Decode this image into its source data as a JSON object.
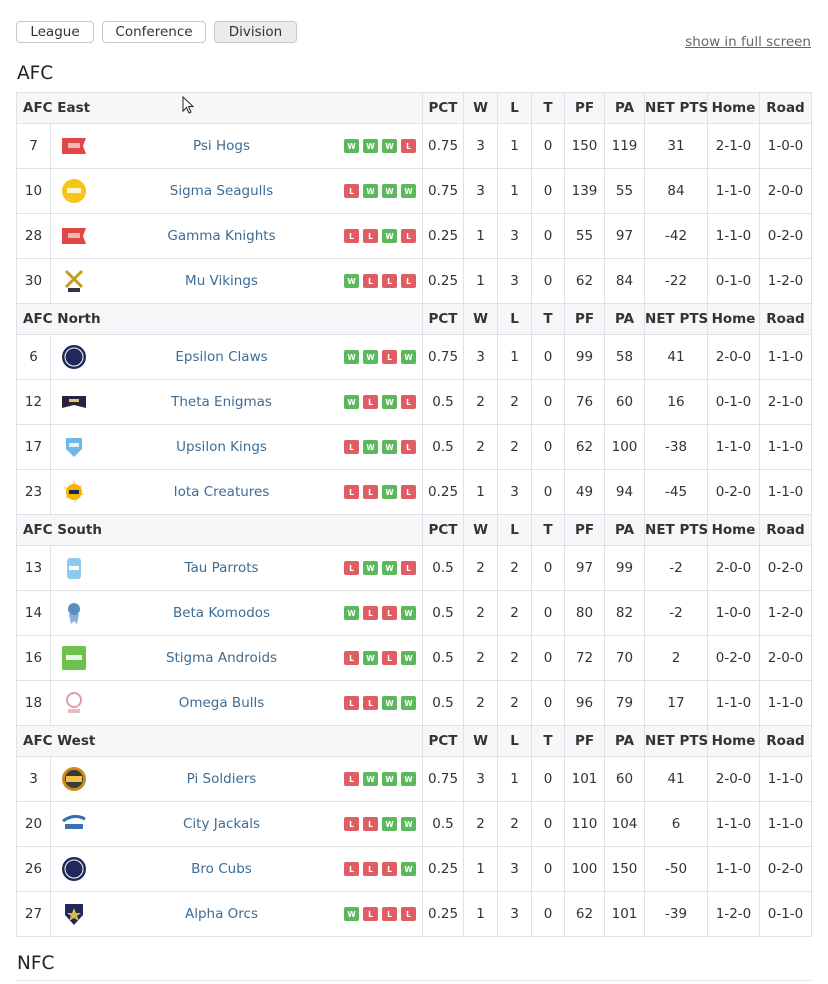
{
  "tabs": [
    {
      "label": "League",
      "active": false
    },
    {
      "label": "Conference",
      "active": false
    },
    {
      "label": "Division",
      "active": true
    }
  ],
  "fullscreen_link": "show in full screen",
  "conferences": [
    {
      "name": "AFC",
      "divisions": [
        {
          "name": "AFC East",
          "teams": [
            {
              "seed": "7",
              "name": "Psi Hogs",
              "logo": "red-flag-logo",
              "streak": [
                "W",
                "W",
                "W",
                "L"
              ],
              "pct": "0.75",
              "w": "3",
              "l": "1",
              "t": "0",
              "pf": "150",
              "pa": "119",
              "net": "31",
              "home": "2-1-0",
              "road": "1-0-0"
            },
            {
              "seed": "10",
              "name": "Sigma Seagulls",
              "logo": "yellow-circle-logo",
              "streak": [
                "L",
                "W",
                "W",
                "W"
              ],
              "pct": "0.75",
              "w": "3",
              "l": "1",
              "t": "0",
              "pf": "139",
              "pa": "55",
              "net": "84",
              "home": "1-1-0",
              "road": "2-0-0"
            },
            {
              "seed": "28",
              "name": "Gamma Knights",
              "logo": "red-flag-logo",
              "streak": [
                "L",
                "L",
                "W",
                "L"
              ],
              "pct": "0.25",
              "w": "1",
              "l": "3",
              "t": "0",
              "pf": "55",
              "pa": "97",
              "net": "-42",
              "home": "1-1-0",
              "road": "0-2-0"
            },
            {
              "seed": "30",
              "name": "Mu Vikings",
              "logo": "crossed-axes-logo",
              "streak": [
                "W",
                "L",
                "L",
                "L"
              ],
              "pct": "0.25",
              "w": "1",
              "l": "3",
              "t": "0",
              "pf": "62",
              "pa": "84",
              "net": "-22",
              "home": "0-1-0",
              "road": "1-2-0"
            }
          ]
        },
        {
          "name": "AFC North",
          "teams": [
            {
              "seed": "6",
              "name": "Epsilon Claws",
              "logo": "navy-circle-logo",
              "streak": [
                "W",
                "W",
                "L",
                "W"
              ],
              "pct": "0.75",
              "w": "3",
              "l": "1",
              "t": "0",
              "pf": "99",
              "pa": "58",
              "net": "41",
              "home": "2-0-0",
              "road": "1-1-0"
            },
            {
              "seed": "12",
              "name": "Theta Enigmas",
              "logo": "dark-banner-logo",
              "streak": [
                "W",
                "L",
                "W",
                "L"
              ],
              "pct": "0.5",
              "w": "2",
              "l": "2",
              "t": "0",
              "pf": "76",
              "pa": "60",
              "net": "16",
              "home": "0-1-0",
              "road": "2-1-0"
            },
            {
              "seed": "17",
              "name": "Upsilon Kings",
              "logo": "blue-shield-logo",
              "streak": [
                "L",
                "W",
                "W",
                "L"
              ],
              "pct": "0.5",
              "w": "2",
              "l": "2",
              "t": "0",
              "pf": "62",
              "pa": "100",
              "net": "-38",
              "home": "1-1-0",
              "road": "1-1-0"
            },
            {
              "seed": "23",
              "name": "Iota Creatures",
              "logo": "sun-star-logo",
              "streak": [
                "L",
                "L",
                "W",
                "L"
              ],
              "pct": "0.25",
              "w": "1",
              "l": "3",
              "t": "0",
              "pf": "49",
              "pa": "94",
              "net": "-45",
              "home": "0-2-0",
              "road": "1-1-0"
            }
          ]
        },
        {
          "name": "AFC South",
          "teams": [
            {
              "seed": "13",
              "name": "Tau Parrots",
              "logo": "light-blue-bottle-logo",
              "streak": [
                "L",
                "W",
                "W",
                "L"
              ],
              "pct": "0.5",
              "w": "2",
              "l": "2",
              "t": "0",
              "pf": "97",
              "pa": "99",
              "net": "-2",
              "home": "2-0-0",
              "road": "0-2-0"
            },
            {
              "seed": "14",
              "name": "Beta Komodos",
              "logo": "medal-logo",
              "streak": [
                "W",
                "L",
                "L",
                "W"
              ],
              "pct": "0.5",
              "w": "2",
              "l": "2",
              "t": "0",
              "pf": "80",
              "pa": "82",
              "net": "-2",
              "home": "1-0-0",
              "road": "1-2-0"
            },
            {
              "seed": "16",
              "name": "Stigma Androids",
              "logo": "green-square-logo",
              "streak": [
                "L",
                "W",
                "L",
                "W"
              ],
              "pct": "0.5",
              "w": "2",
              "l": "2",
              "t": "0",
              "pf": "72",
              "pa": "70",
              "net": "2",
              "home": "0-2-0",
              "road": "2-0-0"
            },
            {
              "seed": "18",
              "name": "Omega Bulls",
              "logo": "pink-crest-logo",
              "streak": [
                "L",
                "L",
                "W",
                "W"
              ],
              "pct": "0.5",
              "w": "2",
              "l": "2",
              "t": "0",
              "pf": "96",
              "pa": "79",
              "net": "17",
              "home": "1-1-0",
              "road": "1-1-0"
            }
          ]
        },
        {
          "name": "AFC West",
          "teams": [
            {
              "seed": "3",
              "name": "Pi Soldiers",
              "logo": "gold-badge-logo",
              "streak": [
                "L",
                "W",
                "W",
                "W"
              ],
              "pct": "0.75",
              "w": "3",
              "l": "1",
              "t": "0",
              "pf": "101",
              "pa": "60",
              "net": "41",
              "home": "2-0-0",
              "road": "1-1-0"
            },
            {
              "seed": "20",
              "name": "City Jackals",
              "logo": "blue-sport-script-logo",
              "streak": [
                "L",
                "L",
                "W",
                "W"
              ],
              "pct": "0.5",
              "w": "2",
              "l": "2",
              "t": "0",
              "pf": "110",
              "pa": "104",
              "net": "6",
              "home": "1-1-0",
              "road": "1-1-0"
            },
            {
              "seed": "26",
              "name": "Bro Cubs",
              "logo": "navy-circle-logo",
              "streak": [
                "L",
                "L",
                "L",
                "W"
              ],
              "pct": "0.25",
              "w": "1",
              "l": "3",
              "t": "0",
              "pf": "100",
              "pa": "150",
              "net": "-50",
              "home": "1-1-0",
              "road": "0-2-0"
            },
            {
              "seed": "27",
              "name": "Alpha Orcs",
              "logo": "navy-shield-logo",
              "streak": [
                "W",
                "L",
                "L",
                "L"
              ],
              "pct": "0.25",
              "w": "1",
              "l": "3",
              "t": "0",
              "pf": "62",
              "pa": "101",
              "net": "-39",
              "home": "1-2-0",
              "road": "0-1-0"
            }
          ]
        }
      ]
    },
    {
      "name": "NFC",
      "divisions": []
    }
  ],
  "columns": [
    "PCT",
    "W",
    "L",
    "T",
    "PF",
    "PA",
    "NET PTS",
    "Home",
    "Road"
  ],
  "colors": {
    "win": "#5cb85c",
    "loss": "#e05d63",
    "link": "#3d6c94",
    "header_bg": "#f7f7f9",
    "border": "#dee2e6"
  }
}
